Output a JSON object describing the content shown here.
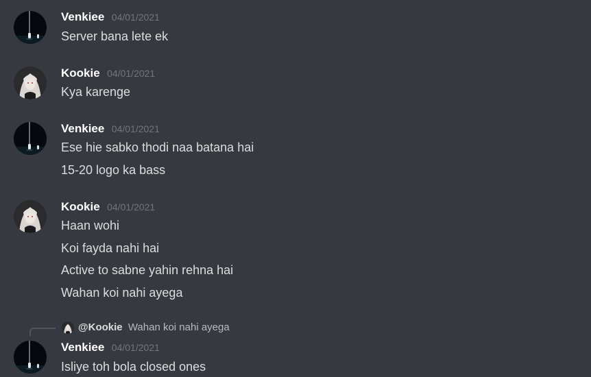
{
  "messages": [
    {
      "author": "Venkiee",
      "avatar_icon": "venkiee-dark-bottles-avatar",
      "timestamp": "04/01/2021",
      "lines": [
        "Server bana lete ek"
      ]
    },
    {
      "author": "Kookie",
      "avatar_icon": "kookie-anime-girl-avatar",
      "timestamp": "04/01/2021",
      "lines": [
        "Kya karenge"
      ]
    },
    {
      "author": "Venkiee",
      "avatar_icon": "venkiee-dark-bottles-avatar",
      "timestamp": "04/01/2021",
      "lines": [
        "Ese hie sabko thodi naa batana hai",
        "15-20 logo ka bass"
      ]
    },
    {
      "author": "Kookie",
      "avatar_icon": "kookie-anime-girl-avatar",
      "timestamp": "04/01/2021",
      "lines": [
        "Haan wohi",
        "Koi fayda nahi hai",
        "Active to sabne yahin rehna hai",
        "Wahan koi nahi ayega"
      ]
    },
    {
      "author": "Venkiee",
      "avatar_icon": "venkiee-dark-bottles-avatar",
      "timestamp": "04/01/2021",
      "reply": {
        "mention": "@Kookie",
        "preview": "Wahan koi nahi ayega"
      },
      "lines": [
        "Isliye toh bola closed ones"
      ]
    }
  ],
  "colors": {
    "background": "#36393f",
    "username": "#ffffff",
    "timestamp": "#72767d",
    "message_text": "#dcddde"
  }
}
